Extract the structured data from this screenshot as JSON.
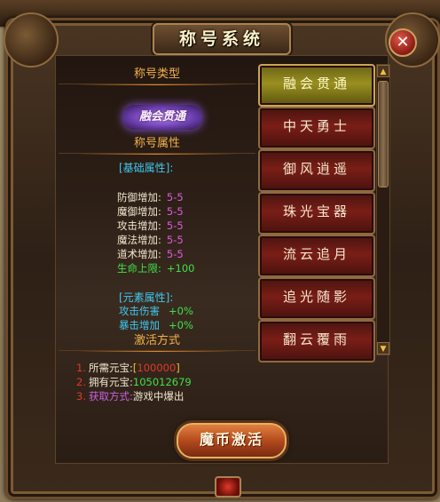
{
  "window": {
    "title": "称号系统",
    "close_symbol": "✕"
  },
  "left": {
    "type_header": "称号类型",
    "badge_text": "融会贯通",
    "attr_header": "称号属性",
    "basic_label": "[基础属性]:",
    "basic_attrs": [
      {
        "name": "防御增加:",
        "value": "5-5"
      },
      {
        "name": "魔御增加:",
        "value": "5-5"
      },
      {
        "name": "攻击增加:",
        "value": "5-5"
      },
      {
        "name": "魔法增加:",
        "value": "5-5"
      },
      {
        "name": "道术增加:",
        "value": "5-5"
      }
    ],
    "hp_attr": {
      "name": "生命上限:",
      "value": "+100"
    },
    "element_label": "[元素属性]:",
    "element_attrs": [
      {
        "name": "攻击伤害",
        "value": "+0%"
      },
      {
        "name": "暴击增加",
        "value": "+0%"
      }
    ],
    "activation_header": "激活方式",
    "requirements": [
      {
        "num": "1.",
        "label": "所需元宝:",
        "bracket_open": "[",
        "value": "100000",
        "bracket_close": "]"
      },
      {
        "num": "2.",
        "label": "拥有元宝:",
        "value": "105012679"
      },
      {
        "num": "3.",
        "label": "获取方式:",
        "value": "游戏中爆出"
      }
    ]
  },
  "titles": [
    {
      "label": "融会贯通",
      "active": true
    },
    {
      "label": "中天勇士",
      "active": false
    },
    {
      "label": "御风逍遥",
      "active": false
    },
    {
      "label": "珠光宝器",
      "active": false
    },
    {
      "label": "流云追月",
      "active": false
    },
    {
      "label": "追光随影",
      "active": false
    },
    {
      "label": "翻云覆雨",
      "active": false
    }
  ],
  "scroll": {
    "up_symbol": "▲",
    "down_symbol": "▼"
  },
  "activate_button": "魔币激活",
  "colors": {
    "accent_orange": "#f2b24a",
    "attr_purple": "#e05adf",
    "green": "#3fe04a",
    "cyan": "#3ec9f0",
    "active_button": "#9a8f1f",
    "red_button": "#7a1e16"
  }
}
